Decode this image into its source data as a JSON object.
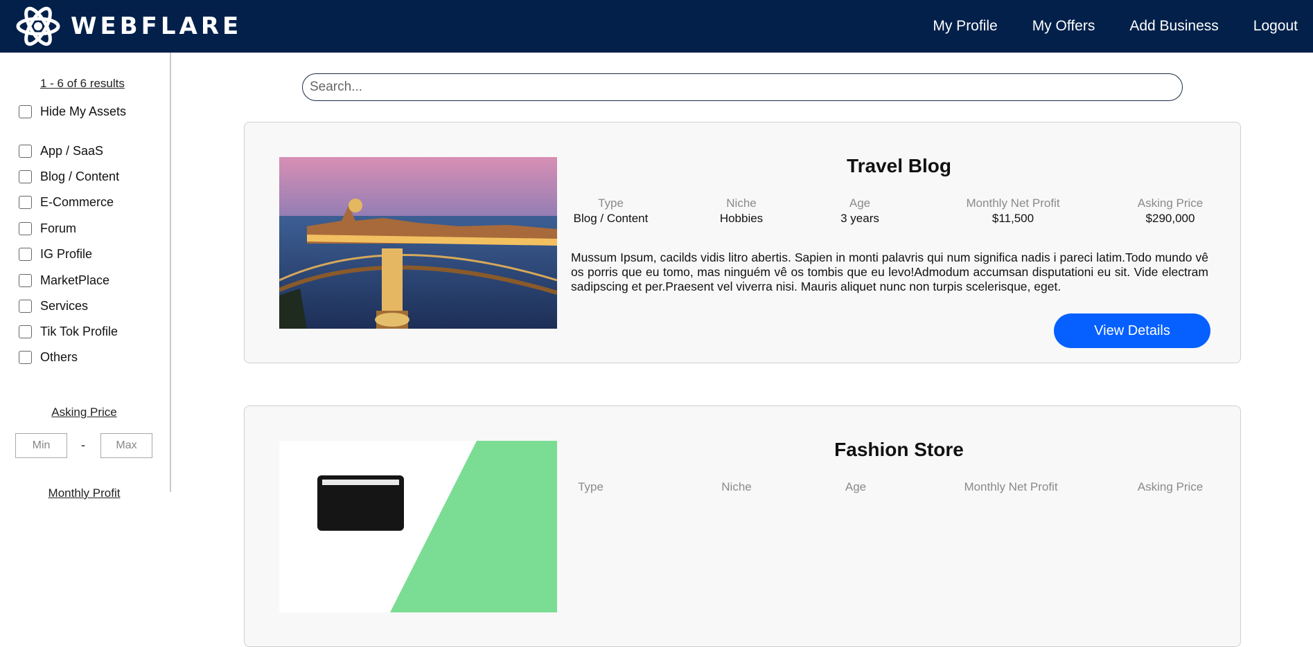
{
  "brand": {
    "name": "WEBFLARE"
  },
  "nav": [
    {
      "label": "My Profile"
    },
    {
      "label": "My Offers"
    },
    {
      "label": "Add Business"
    },
    {
      "label": "Logout"
    }
  ],
  "sidebar": {
    "results": "1 - 6 of 6 results",
    "hide_assets": "Hide My Assets",
    "categories": [
      "App / SaaS",
      "Blog / Content",
      "E-Commerce",
      "Forum",
      "IG Profile",
      "MarketPlace",
      "Services",
      "Tik Tok Profile",
      "Others"
    ],
    "asking_price_title": "Asking Price",
    "min_placeholder": "Min",
    "range_dash": "-",
    "max_placeholder": "Max",
    "monthly_profit_title": "Monthly Profit"
  },
  "search": {
    "placeholder": "Search..."
  },
  "stat_labels": {
    "type": "Type",
    "niche": "Niche",
    "age": "Age",
    "profit": "Monthly Net Profit",
    "price": "Asking Price"
  },
  "listings": [
    {
      "title": "Travel Blog",
      "type": "Blog / Content",
      "niche": "Hobbies",
      "age": "3 years",
      "profit": "$11,500",
      "price": "$290,000",
      "description": "Mussum Ipsum, cacilds vidis litro abertis. Sapien in monti palavris qui num significa nadis i pareci latim.Todo mundo vê os porris que eu tomo, mas ninguém vê os tombis que eu levo!Admodum accumsan disputationi eu sit. Vide electram sadipscing et per.Praesent vel viverra nisi. Mauris aliquet nunc non turpis scelerisque, eget.",
      "button": "View Details"
    },
    {
      "title": "Fashion Store"
    }
  ],
  "colors": {
    "navbar": "#02204a",
    "button": "#0660ff",
    "card_bg": "#f8f8f8"
  }
}
